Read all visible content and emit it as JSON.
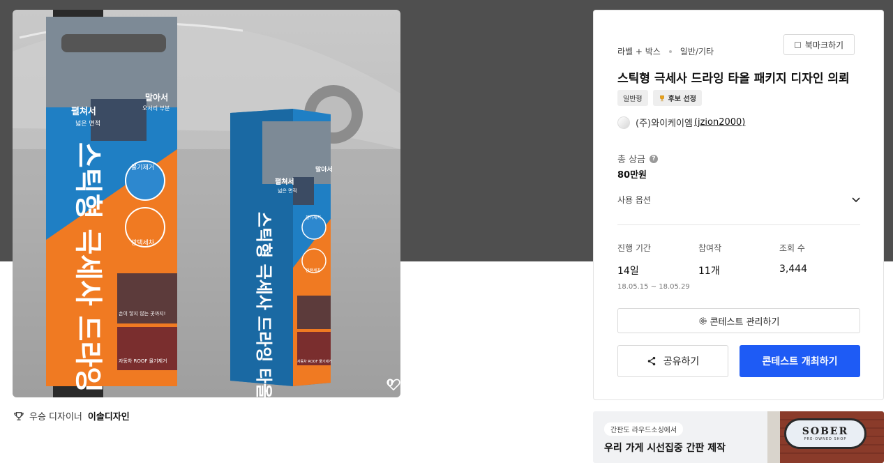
{
  "hero": {
    "like_count": "0",
    "box_large": {
      "tab_spread": "펼쳐서",
      "tab_spread_sub": "넓은 면적",
      "tab_roll": "말아서",
      "tab_roll_sub": "오서리 부분",
      "brand_vertical": "스틱형 극세사 드라잉 타올",
      "badge_water": "물기제거",
      "badge_gloss": "광택세차",
      "photo_caption_1": "손이 닿지 않는 곳까지!",
      "photo_caption_2": "자동차 ROOF 물기제거"
    },
    "box_small": {
      "tab_spread": "펼쳐서",
      "tab_spread_sub": "넓은 면적",
      "tab_roll": "말아서",
      "brand_vertical": "스틱형 극세사 드라잉 타올",
      "badge_water": "물기제거",
      "badge_gloss": "광택세차",
      "photo_caption": "자동차 ROOF 물기제거"
    }
  },
  "winner": {
    "prefix": "우승 디자이너",
    "name": "이솔디자인"
  },
  "card": {
    "category_1": "라벨 + 박스",
    "category_2": "일반/기타",
    "bookmark_label": "북마크하기",
    "title": "스틱형 극세사 드라잉 타올 패키지 디자인 의뢰",
    "tag_general": "일반형",
    "tag_candidate": "후보 선정",
    "host_name": "(주)와이케이엠",
    "host_id": "(jzion2000)",
    "prize_label": "총 상금",
    "prize_value": "80만원",
    "options_label": "사용 옵션",
    "stats": {
      "period_label": "진행 기간",
      "period_value": "14일",
      "period_range": "18.05.15 ~ 18.05.29",
      "entries_label": "참여작",
      "entries_value": "11개",
      "views_label": "조회 수",
      "views_value": "3,444"
    },
    "manage_label": "콘테스트 관리하기",
    "share_label": "공유하기",
    "host_button_label": "콘테스트 개최하기"
  },
  "ad": {
    "pill": "간판도 라우드소싱에서",
    "headline": "우리 가게 시선집중 간판 제작",
    "sign_brand": "SOBER",
    "sign_sub": "PRE-OWNED SHOP"
  },
  "colors": {
    "primary": "#1e5bf5",
    "box_blue": "#1f7fc4",
    "box_orange": "#f07a22"
  }
}
